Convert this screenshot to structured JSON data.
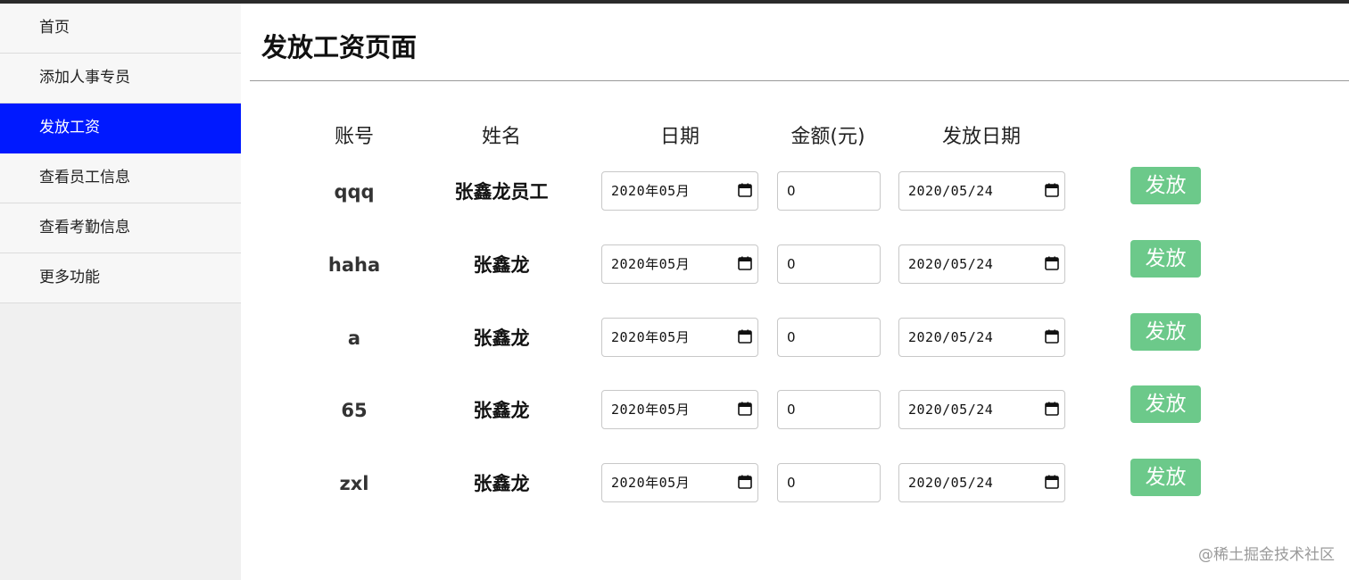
{
  "sidebar": {
    "items": [
      {
        "label": "首页"
      },
      {
        "label": "添加人事专员"
      },
      {
        "label": "发放工资"
      },
      {
        "label": "查看员工信息"
      },
      {
        "label": "查看考勤信息"
      },
      {
        "label": "更多功能"
      }
    ],
    "active_index": 2
  },
  "page": {
    "title": "发放工资页面"
  },
  "table": {
    "headers": {
      "account": "账号",
      "name": "姓名",
      "date": "日期",
      "amount": "金额(元)",
      "pay_date": "发放日期"
    },
    "rows": [
      {
        "account": "qqq",
        "name": "张鑫龙员工",
        "date": "2020年05月",
        "amount": "0",
        "pay_date": "2020/05/24",
        "action": "发放"
      },
      {
        "account": "haha",
        "name": "张鑫龙",
        "date": "2020年05月",
        "amount": "0",
        "pay_date": "2020/05/24",
        "action": "发放"
      },
      {
        "account": "a",
        "name": "张鑫龙",
        "date": "2020年05月",
        "amount": "0",
        "pay_date": "2020/05/24",
        "action": "发放"
      },
      {
        "account": "65",
        "name": "张鑫龙",
        "date": "2020年05月",
        "amount": "0",
        "pay_date": "2020/05/24",
        "action": "发放"
      },
      {
        "account": "zxl",
        "name": "张鑫龙",
        "date": "2020年05月",
        "amount": "0",
        "pay_date": "2020/05/24",
        "action": "发放"
      }
    ]
  },
  "watermark": "@稀土掘金技术社区",
  "colors": {
    "active_nav": "#0019ff",
    "button": "#6cc98a"
  }
}
